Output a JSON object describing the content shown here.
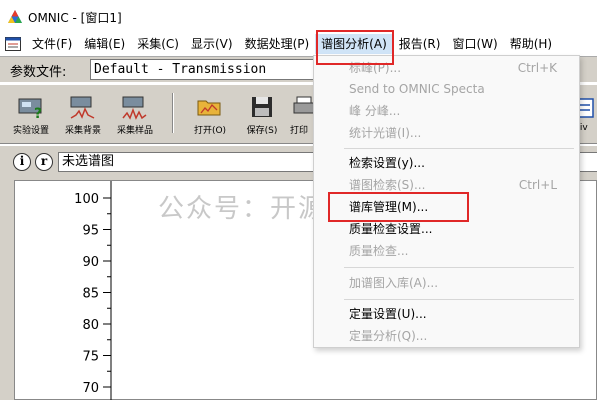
{
  "window": {
    "title": "OMNIC - [窗口1]"
  },
  "menubar": {
    "items": [
      "文件(F)",
      "编辑(E)",
      "采集(C)",
      "显示(V)",
      "数据处理(P)",
      "谱图分析(A)",
      "报告(R)",
      "窗口(W)",
      "帮助(H)"
    ]
  },
  "params": {
    "label": "参数文件:",
    "value": "Default - Transmission"
  },
  "toolbar": {
    "buttons": [
      "实验设置",
      "采集背景",
      "采集样品",
      "打开(O)",
      "保存(S)",
      "打印"
    ],
    "partial_label": "tiv"
  },
  "info": {
    "btn_i": "i",
    "btn_r": "r",
    "spectrum_title": "未选谱图"
  },
  "plot": {
    "yticks": [
      "100",
      "95",
      "90",
      "85",
      "80",
      "75",
      "70"
    ]
  },
  "dropdown": {
    "items": [
      {
        "label": "标峰(P)...",
        "shortcut": "Ctrl+K",
        "enabled": false
      },
      {
        "label": "Send to OMNIC Specta",
        "shortcut": "",
        "enabled": false
      },
      {
        "label": "峰 分峰...",
        "shortcut": "",
        "enabled": false
      },
      {
        "label": "统计光谱(I)...",
        "shortcut": "",
        "enabled": false
      },
      {
        "label": "检索设置(y)...",
        "shortcut": "",
        "enabled": true
      },
      {
        "label": "谱图检索(S)...",
        "shortcut": "Ctrl+L",
        "enabled": false
      },
      {
        "label": "谱库管理(M)...",
        "shortcut": "",
        "enabled": true
      },
      {
        "label": "质量检查设置...",
        "shortcut": "",
        "enabled": true
      },
      {
        "label": "质量检查...",
        "shortcut": "",
        "enabled": false
      },
      {
        "label": "加谱图入库(A)...",
        "shortcut": "",
        "enabled": false
      },
      {
        "label": "定量设置(U)...",
        "shortcut": "",
        "enabled": true
      },
      {
        "label": "定量分析(Q)...",
        "shortcut": "",
        "enabled": false
      }
    ]
  },
  "watermark": {
    "text": "公众号：开源仪器"
  },
  "colors": {
    "highlight": "#e02828",
    "chrome": "#d4d0c8",
    "menu_active": "#d0e4f7",
    "disabled_text": "#a5a5a5"
  }
}
